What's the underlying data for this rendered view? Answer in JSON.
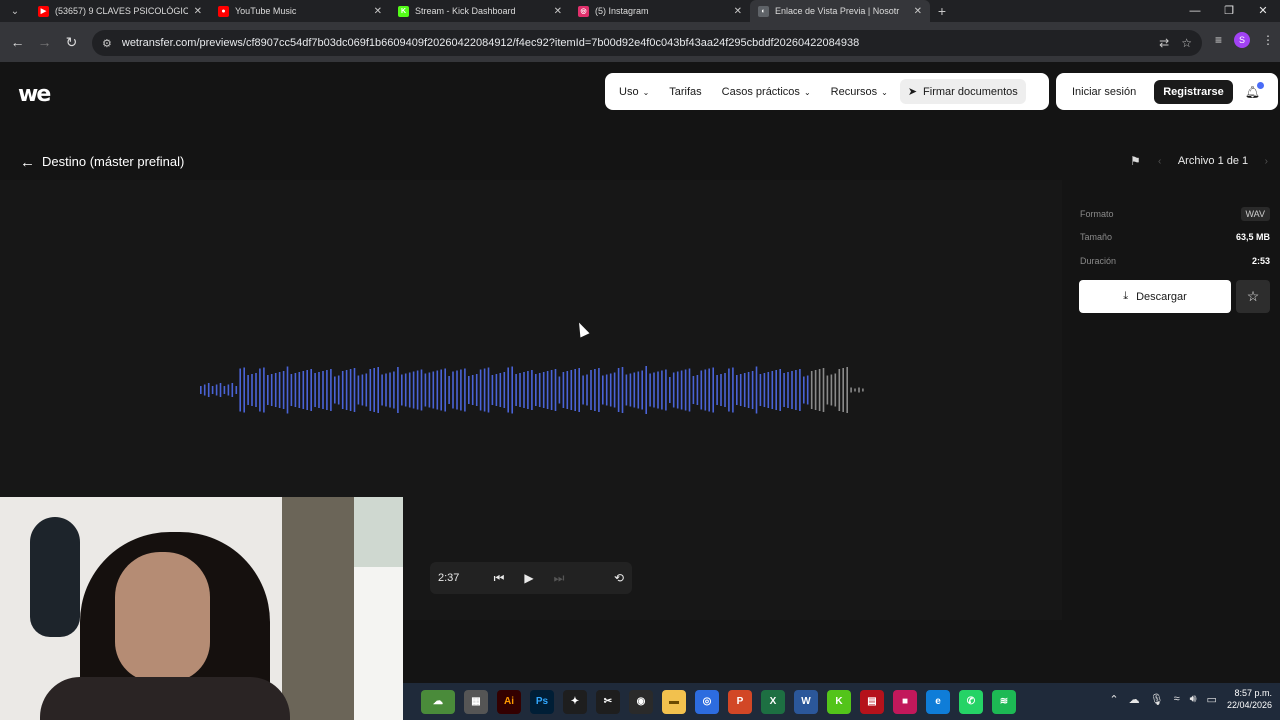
{
  "browser": {
    "tabs": [
      {
        "label": "(53657) 9 CLAVES PSICOLÓGIC",
        "icon": "youtube-icon",
        "color": "#ff0000",
        "glyph": "▶"
      },
      {
        "label": "YouTube Music",
        "icon": "youtube-music-icon",
        "color": "#ff0000",
        "glyph": "●"
      },
      {
        "label": "Stream - Kick Dashboard",
        "icon": "kick-icon",
        "color": "#53fc18",
        "glyph": "K"
      },
      {
        "label": "(5) Instagram",
        "icon": "instagram-icon",
        "color": "#e1306c",
        "glyph": "◎"
      },
      {
        "label": "Enlace de Vista Previa | Nosotr",
        "icon": "wetransfer-icon",
        "color": "#5f6368",
        "glyph": "◐"
      }
    ],
    "url": "wetransfer.com/previews/cf8907cc54df7b03dc069f1b6609409f20260422084912/f4ec92?itemId=7b00d92e4f0c043bf43aa24f295cbddf20260422084938",
    "profile_initial": "S"
  },
  "site": {
    "logo": "we",
    "nav": {
      "uso": "Uso",
      "tarifas": "Tarifas",
      "casos": "Casos prácticos",
      "recursos": "Recursos",
      "firmar": "Firmar documentos"
    },
    "auth": {
      "login": "Iniciar sesión",
      "register": "Registrarse"
    }
  },
  "file": {
    "title": "Destino (máster prefinal)",
    "pager": "Archivo 1 de 1",
    "format_label": "Formato",
    "format_value": "WAV",
    "size_label": "Tamaño",
    "size_value": "63,5 MB",
    "duration_label": "Duración",
    "duration_value": "2:53",
    "download_label": "Descargar"
  },
  "player": {
    "current_time": "2:37",
    "progress": 0.9075
  },
  "colors": {
    "played": "#4a63d6",
    "unplayed": "#8a8a8a",
    "accent": "#4a6cf7"
  },
  "system": {
    "time": "8:57 p.m.",
    "date": "22/04/2026"
  }
}
